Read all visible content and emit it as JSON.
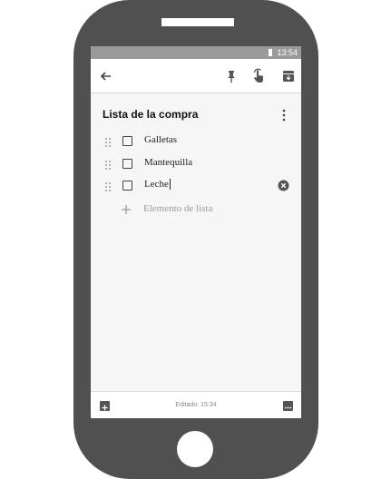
{
  "status_bar": {
    "time": "13:54"
  },
  "toolbar": {
    "icons": [
      "back-arrow-icon",
      "pin-icon",
      "reminder-icon",
      "archive-icon"
    ]
  },
  "note": {
    "title": "Lista de la compra",
    "items": [
      {
        "label": "Galletas",
        "checked": false
      },
      {
        "label": "Mantequilla",
        "checked": false
      },
      {
        "label": "Leche",
        "checked": false,
        "editing": true
      }
    ],
    "add_item_placeholder": "Elemento de lista"
  },
  "bottom_bar": {
    "edited_text": "Editado: 15:34"
  },
  "colors": {
    "phone_body": "#505050",
    "status_bar": "#9a9a9a",
    "screen_bg": "#f6f6f6"
  }
}
